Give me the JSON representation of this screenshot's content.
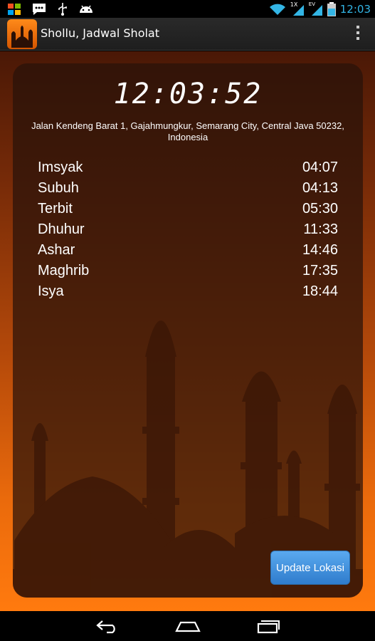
{
  "status_bar": {
    "time": "12:03",
    "network_label_1": "1X",
    "network_label_2": "EV",
    "icons": [
      "windows-flag-icon",
      "chat-icon",
      "usb-icon",
      "android-icon",
      "wifi-icon",
      "signal-icon",
      "battery-icon"
    ]
  },
  "action_bar": {
    "title": "Shollu, Jadwal Sholat"
  },
  "clock": "12:03:52",
  "location": {
    "address": "Jalan Kendeng Barat 1, Gajahmungkur, Semarang City, Central Java 50232, Indonesia"
  },
  "prayers": [
    {
      "name": "Imsyak",
      "time": "04:07"
    },
    {
      "name": "Subuh",
      "time": "04:13"
    },
    {
      "name": "Terbit",
      "time": "05:30"
    },
    {
      "name": "Dhuhur",
      "time": "11:33"
    },
    {
      "name": "Ashar",
      "time": "14:46"
    },
    {
      "name": "Maghrib",
      "time": "17:35"
    },
    {
      "name": "Isya",
      "time": "18:44"
    }
  ],
  "update_button": {
    "label": "Update Lokasi"
  },
  "colors": {
    "accent_clock": "#33b5e5",
    "button": "#3d8fd9",
    "background_orange": "#ff7a0e"
  }
}
